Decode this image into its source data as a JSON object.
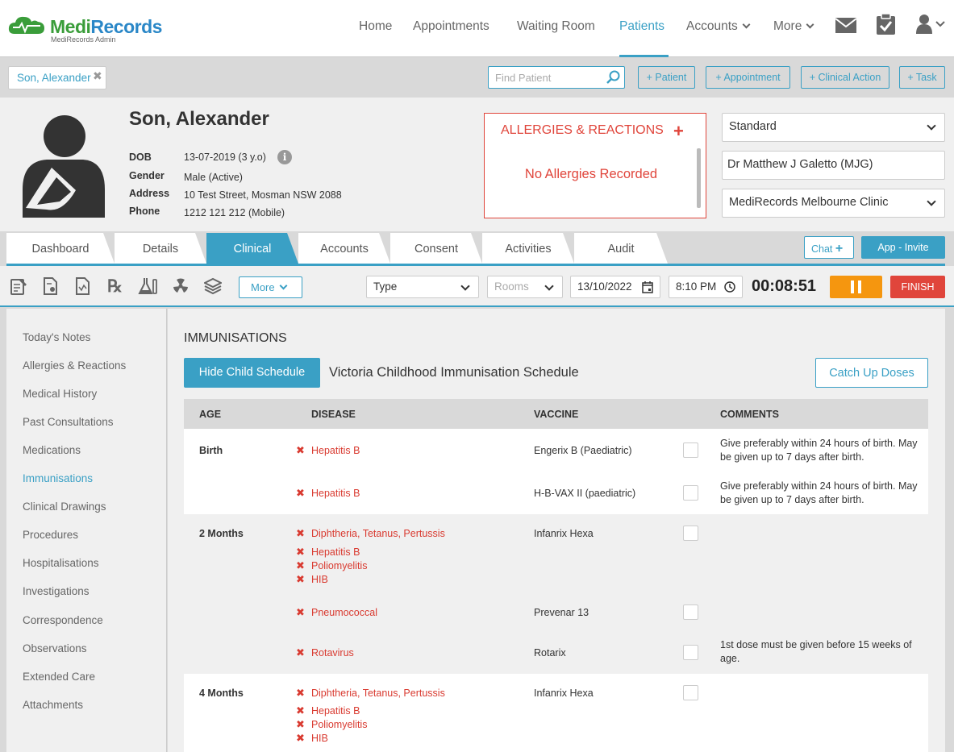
{
  "brand": {
    "name_part1": "Medi",
    "name_part2": "Records",
    "subtitle": "MediRecords Admin"
  },
  "nav": {
    "items": [
      {
        "label": "Home",
        "active": false
      },
      {
        "label": "Appointments",
        "active": false
      },
      {
        "label": "Waiting Room",
        "active": false
      },
      {
        "label": "Patients",
        "active": true
      },
      {
        "label": "Accounts",
        "active": false,
        "dropdown": true
      },
      {
        "label": "More",
        "active": false,
        "dropdown": true
      }
    ],
    "icons": [
      "mail-icon",
      "clipboard-check-icon",
      "user-icon"
    ]
  },
  "patient_tab": {
    "label": "Son, Alexander",
    "close": "✖"
  },
  "search": {
    "placeholder": "Find Patient"
  },
  "actions": [
    "+ Patient",
    "+ Appointment",
    "+ Clinical Action",
    "+ Task"
  ],
  "patient": {
    "name": "Son, Alexander",
    "fields": [
      {
        "label": "DOB",
        "value": "13-07-2019 (3 y.o)"
      },
      {
        "label": "Gender",
        "value": "Male (Active)"
      },
      {
        "label": "Address",
        "value": "10 Test Street, Mosman NSW 2088"
      },
      {
        "label": "Phone",
        "value": "1212 121 212 (Mobile)"
      }
    ]
  },
  "allergies": {
    "title": "ALLERGIES & REACTIONS",
    "add": "+",
    "empty": "No Allergies Recorded"
  },
  "selectors": {
    "type": "Standard",
    "doctor": "Dr Matthew J Galetto (MJG)",
    "clinic": "MediRecords Melbourne Clinic"
  },
  "tabs": [
    {
      "label": "Dashboard",
      "active": false
    },
    {
      "label": "Details",
      "active": false
    },
    {
      "label": "Clinical",
      "active": true
    },
    {
      "label": "Accounts",
      "active": false
    },
    {
      "label": "Consent",
      "active": false
    },
    {
      "label": "Activities",
      "active": false
    },
    {
      "label": "Audit",
      "active": false
    }
  ],
  "chat": {
    "label": "Chat",
    "plus": "+"
  },
  "app_invite": "App - Invite",
  "toolbar": {
    "icons": [
      "notes-icon",
      "document-icon",
      "report-icon",
      "prescription-icon",
      "lab-icon",
      "radiation-icon",
      "books-icon"
    ],
    "more_label": "More",
    "type_label": "Type",
    "rooms_label": "Rooms",
    "date": "13/10/2022",
    "time": "8:10 PM",
    "timer": "00:08:51",
    "finish_label": "FINISH"
  },
  "sidebar": {
    "items": [
      {
        "label": "Today's Notes",
        "active": false
      },
      {
        "label": "Allergies & Reactions",
        "active": false
      },
      {
        "label": "Medical History",
        "active": false
      },
      {
        "label": "Past Consultations",
        "active": false
      },
      {
        "label": "Medications",
        "active": false
      },
      {
        "label": "Immunisations",
        "active": true
      },
      {
        "label": "Clinical Drawings",
        "active": false
      },
      {
        "label": "Procedures",
        "active": false
      },
      {
        "label": "Hospitalisations",
        "active": false
      },
      {
        "label": "Investigations",
        "active": false
      },
      {
        "label": "Correspondence",
        "active": false
      },
      {
        "label": "Observations",
        "active": false
      },
      {
        "label": "Extended Care",
        "active": false
      },
      {
        "label": "Attachments",
        "active": false
      }
    ]
  },
  "immunisations": {
    "title": "IMMUNISATIONS",
    "hide_button": "Hide Child Schedule",
    "schedule_title": "Victoria Childhood Immunisation Schedule",
    "catchup_button": "Catch Up Doses",
    "headers": {
      "age": "AGE",
      "disease": "DISEASE",
      "vaccine": "VACCINE",
      "comments": "COMMENTS"
    },
    "rows": [
      {
        "age": "Birth",
        "diseases": [
          "Hepatitis B"
        ],
        "vaccine": "Engerix B (Paediatric)",
        "comment": "Give preferably within 24 hours of birth. May be given up to 7 days after birth."
      },
      {
        "age": "",
        "diseases": [
          "Hepatitis B"
        ],
        "vaccine": "H-B-VAX II (paediatric)",
        "comment": "Give preferably within 24 hours of birth. May be given up to 7 days after birth."
      },
      {
        "age": "2 Months",
        "diseases": [
          "Diphtheria, Tetanus, Pertussis",
          "Hepatitis B",
          "Poliomyelitis",
          "HIB"
        ],
        "vaccine": "Infanrix Hexa",
        "comment": ""
      },
      {
        "age": "",
        "diseases": [
          "Pneumococcal"
        ],
        "vaccine": "Prevenar 13",
        "comment": ""
      },
      {
        "age": "",
        "diseases": [
          "Rotavirus"
        ],
        "vaccine": "Rotarix",
        "comment": "1st dose must be given before 15 weeks of age."
      },
      {
        "age": "4 Months",
        "diseases": [
          "Diphtheria, Tetanus, Pertussis",
          "Hepatitis B",
          "Poliomyelitis",
          "HIB"
        ],
        "vaccine": "Infanrix Hexa",
        "comment": ""
      }
    ]
  },
  "colors": {
    "accent": "#3aa0c5",
    "danger": "#e0453b",
    "warning": "#f5960f",
    "brand_green": "#3a9d3a",
    "brand_blue": "#2a87c7"
  }
}
